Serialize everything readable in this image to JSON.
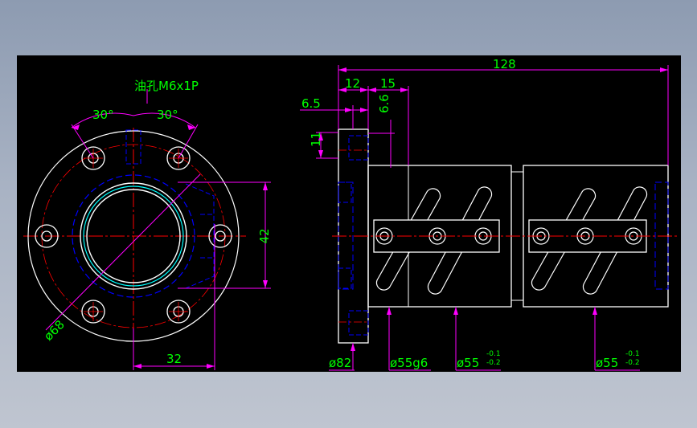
{
  "drawing": {
    "colors": {
      "background": "#000000",
      "outline": "#ffffff",
      "centerline": "#ff0000",
      "hidden": "#0000ff",
      "dimension": "#ff00ff",
      "text": "#00ff00",
      "thread": "#00ffff"
    },
    "front_view": {
      "oil_hole_label": "油孔M6x1P",
      "angle_left": "30°",
      "angle_right": "30°",
      "dim_42": "42",
      "dim_32": "32",
      "dim_phi68": "ø68"
    },
    "side_view": {
      "dim_128": "128",
      "dim_12": "12",
      "dim_15": "15",
      "dim_6_5": "6.5",
      "dim_6_6": "6.6",
      "dim_11": "11",
      "dim_phi82": "ø82",
      "dim_phi55g6": "ø55g6",
      "dim_phi55_a": "ø55",
      "dim_phi55_b": "ø55",
      "tol_upper": "-0.1",
      "tol_lower": "-0.2"
    }
  }
}
